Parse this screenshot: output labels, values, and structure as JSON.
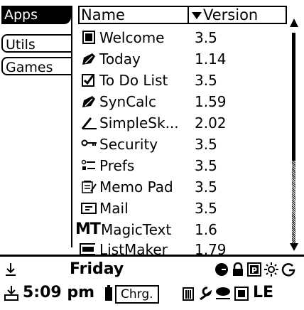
{
  "tabs": [
    {
      "label": "Apps",
      "active": true
    },
    {
      "label": "Utils",
      "active": false
    },
    {
      "label": "Games",
      "active": false
    }
  ],
  "table": {
    "col_name": "Name",
    "col_version": "Version",
    "sort_icon": "triangle-down-icon",
    "rows": [
      {
        "name": "Welcome",
        "version": "3.5",
        "icon": "app-window-icon"
      },
      {
        "name": "Today",
        "version": "1.14",
        "icon": "pen-icon"
      },
      {
        "name": "To Do List",
        "version": "3.5",
        "icon": "checkbox-icon"
      },
      {
        "name": "SynCalc",
        "version": "1.59",
        "icon": "pen-icon"
      },
      {
        "name": "SimpleSk...",
        "version": "2.02",
        "icon": "stylus-icon"
      },
      {
        "name": "Security",
        "version": "3.5",
        "icon": "key-icon"
      },
      {
        "name": "Prefs",
        "version": "3.5",
        "icon": "prefs-icon"
      },
      {
        "name": "Memo Pad",
        "version": "3.5",
        "icon": "memo-icon"
      },
      {
        "name": "Mail",
        "version": "3.5",
        "icon": "mail-icon"
      },
      {
        "name": "MagicText",
        "version": "1.6",
        "icon": "mt-logo",
        "prefix": "MT"
      },
      {
        "name": "ListMaker",
        "version": "1.79",
        "icon": "listmaker-icon"
      }
    ]
  },
  "status": {
    "day": "Friday",
    "time": "5:09 pm",
    "charge_label": "Chrg.",
    "last_partial": "LE"
  }
}
